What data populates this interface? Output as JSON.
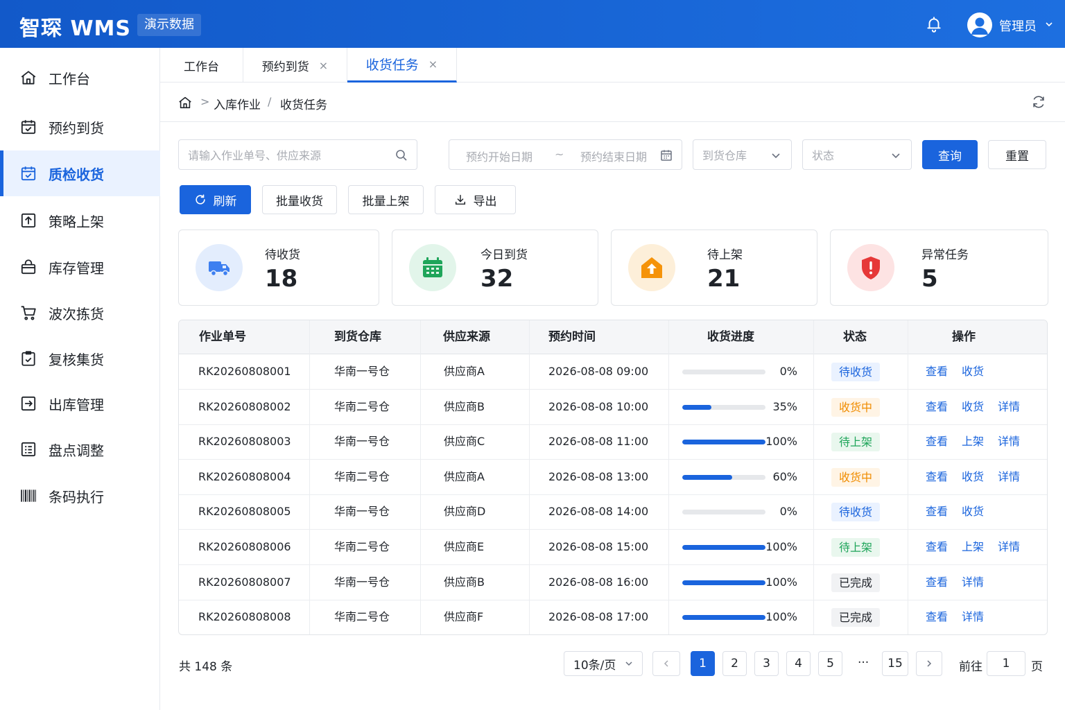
{
  "header": {
    "brand": "智琛 WMS",
    "demo_tag": "演示数据",
    "user_name": "管理员"
  },
  "sidebar": {
    "items": [
      {
        "label": "工作台",
        "icon": "home-icon"
      },
      {
        "label": "预约到货",
        "icon": "calendar-check-icon"
      },
      {
        "label": "质检收货",
        "icon": "calendar-check-icon",
        "active": true
      },
      {
        "label": "策略上架",
        "icon": "upload-box-icon"
      },
      {
        "label": "库存管理",
        "icon": "lock-box-icon"
      },
      {
        "label": "波次拣货",
        "icon": "cart-icon"
      },
      {
        "label": "复核集货",
        "icon": "clipboard-check-icon"
      },
      {
        "label": "出库管理",
        "icon": "exit-box-icon"
      },
      {
        "label": "盘点调整",
        "icon": "list-doc-icon"
      },
      {
        "label": "条码执行",
        "icon": "barcode-icon"
      }
    ]
  },
  "tabs": [
    {
      "label": "工作台",
      "closable": false
    },
    {
      "label": "预约到货",
      "closable": true
    },
    {
      "label": "收货任务",
      "closable": true,
      "active": true
    }
  ],
  "tab_close_glyph": "×",
  "breadcrumb": {
    "separator_1": ">",
    "level_1": "入库作业",
    "separator_2": "/",
    "level_2": "收货任务"
  },
  "filters": {
    "search_placeholder": "请输入作业单号、供应来源",
    "start_date_placeholder": "预约开始日期",
    "date_separator": "~",
    "end_date_placeholder": "预约结束日期",
    "warehouse_placeholder": "到货仓库",
    "status_placeholder": "状态",
    "query_label": "查询",
    "reset_label": "重置"
  },
  "toolbar": {
    "refresh_label": "刷新",
    "batch_receive_label": "批量收货",
    "batch_shelve_label": "批量上架",
    "export_label": "导出"
  },
  "stats": [
    {
      "label": "待收货",
      "value": "18",
      "icon": "truck-icon",
      "color": "#3d7ff0"
    },
    {
      "label": "今日到货",
      "value": "32",
      "icon": "calendar-icon",
      "color": "#1fa55a"
    },
    {
      "label": "待上架",
      "value": "21",
      "icon": "box-up-icon",
      "color": "#f5930a"
    },
    {
      "label": "异常任务",
      "value": "5",
      "icon": "shield-alert-icon",
      "color": "#e63838"
    }
  ],
  "table": {
    "columns": [
      "作业单号",
      "到货仓库",
      "供应来源",
      "预约时间",
      "收货进度",
      "状态",
      "操作"
    ],
    "rows": [
      {
        "id": "RK20260808001",
        "warehouse": "华南一号仓",
        "supplier": "供应商A",
        "time": "2026-08-08 09:00",
        "progress": 0,
        "progress_label": "0%",
        "status": "待收货",
        "status_type": "blue",
        "actions": [
          "查看",
          "收货"
        ]
      },
      {
        "id": "RK20260808002",
        "warehouse": "华南二号仓",
        "supplier": "供应商B",
        "time": "2026-08-08 10:00",
        "progress": 35,
        "progress_label": "35%",
        "status": "收货中",
        "status_type": "orange",
        "actions": [
          "查看",
          "收货",
          "详情"
        ]
      },
      {
        "id": "RK20260808003",
        "warehouse": "华南一号仓",
        "supplier": "供应商C",
        "time": "2026-08-08 11:00",
        "progress": 100,
        "progress_label": "100%",
        "status": "待上架",
        "status_type": "green",
        "actions": [
          "查看",
          "上架",
          "详情"
        ]
      },
      {
        "id": "RK20260808004",
        "warehouse": "华南二号仓",
        "supplier": "供应商A",
        "time": "2026-08-08 13:00",
        "progress": 60,
        "progress_label": "60%",
        "status": "收货中",
        "status_type": "orange",
        "actions": [
          "查看",
          "收货",
          "详情"
        ]
      },
      {
        "id": "RK20260808005",
        "warehouse": "华南一号仓",
        "supplier": "供应商D",
        "time": "2026-08-08 14:00",
        "progress": 0,
        "progress_label": "0%",
        "status": "待收货",
        "status_type": "blue",
        "actions": [
          "查看",
          "收货"
        ]
      },
      {
        "id": "RK20260808006",
        "warehouse": "华南二号仓",
        "supplier": "供应商E",
        "time": "2026-08-08 15:00",
        "progress": 100,
        "progress_label": "100%",
        "status": "待上架",
        "status_type": "green",
        "actions": [
          "查看",
          "上架",
          "详情"
        ]
      },
      {
        "id": "RK20260808007",
        "warehouse": "华南一号仓",
        "supplier": "供应商B",
        "time": "2026-08-08 16:00",
        "progress": 100,
        "progress_label": "100%",
        "status": "已完成",
        "status_type": "gray",
        "actions": [
          "查看",
          "详情"
        ]
      },
      {
        "id": "RK20260808008",
        "warehouse": "华南二号仓",
        "supplier": "供应商F",
        "time": "2026-08-08 17:00",
        "progress": 100,
        "progress_label": "100%",
        "status": "已完成",
        "status_type": "gray",
        "actions": [
          "查看",
          "详情"
        ]
      }
    ]
  },
  "status_colors": {
    "blue": {
      "bg": "#eaf2ff",
      "fg": "#1a64dd"
    },
    "orange": {
      "bg": "#fff4e5",
      "fg": "#f08c00"
    },
    "green": {
      "bg": "#e9f7ee",
      "fg": "#1fa55a"
    },
    "gray": {
      "bg": "#f1f2f4",
      "fg": "#1f2329"
    }
  },
  "pagination": {
    "total_text": "共 148 条",
    "page_size": "10条/页",
    "pages": [
      "1",
      "2",
      "3",
      "4",
      "5"
    ],
    "current_page": "1",
    "ellipsis": "···",
    "last_page": "15",
    "goto_label": "前往",
    "goto_value": "1",
    "page_unit": "页"
  },
  "accent_color": "#1a64dd"
}
